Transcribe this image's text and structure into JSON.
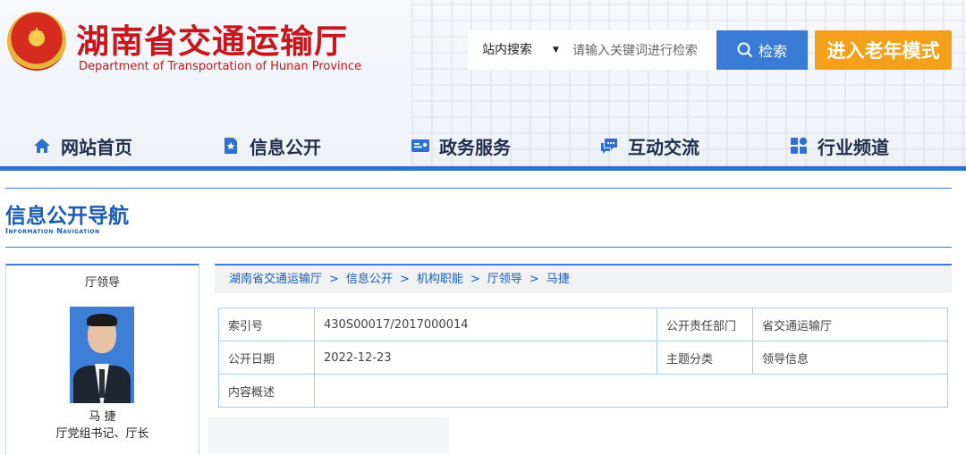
{
  "header": {
    "title": "湖南省交通运输厅",
    "subtitle": "Department of Transportation of Hunan Province",
    "search": {
      "scope": "站内搜索",
      "placeholder": "请输入关键词进行检索",
      "button": "检索"
    },
    "elder_mode": "进入老年模式"
  },
  "nav": {
    "items": [
      {
        "label": "网站首页",
        "icon": "home-icon"
      },
      {
        "label": "信息公开",
        "icon": "document-icon"
      },
      {
        "label": "政务服务",
        "icon": "id-card-icon"
      },
      {
        "label": "互动交流",
        "icon": "chat-icon"
      },
      {
        "label": "行业频道",
        "icon": "grid-icon"
      }
    ]
  },
  "section": {
    "title": "信息公开导航",
    "subtitle": "Information Navigation"
  },
  "leader": {
    "panel_title": "厅领导",
    "name": "马 捷",
    "position": "厅党组书记、厅长"
  },
  "breadcrumb": [
    "湖南省交通运输厅",
    "信息公开",
    "机构职能",
    "厅领导",
    "马捷"
  ],
  "info": {
    "index_label": "索引号",
    "index_value": "430S00017/2017000014",
    "dept_label": "公开责任部门",
    "dept_value": "省交通运输厅",
    "date_label": "公开日期",
    "date_value": "2022-12-23",
    "topic_label": "主题分类",
    "topic_value": "领导信息",
    "summary_label": "内容概述",
    "summary_value": ""
  },
  "colors": {
    "brand_red": "#c8161d",
    "accent_blue": "#3a7bd5",
    "elder_orange": "#f5a01b"
  }
}
